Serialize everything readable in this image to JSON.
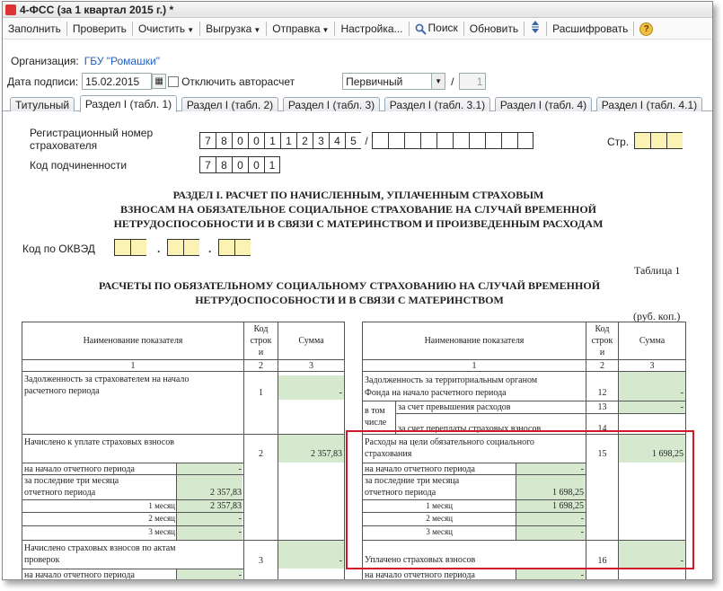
{
  "window": {
    "title": "4-ФСС (за 1 квартал 2015 г.) *"
  },
  "toolbar": {
    "fill": "Заполнить",
    "check": "Проверить",
    "clear": "Очистить",
    "export": "Выгрузка",
    "send": "Отправка",
    "settings": "Настройка...",
    "search": "Поиск",
    "refresh": "Обновить",
    "decrypt": "Расшифровать"
  },
  "org": {
    "label": "Организация:",
    "value": "ГБУ \"Ромашки\""
  },
  "sign": {
    "label": "Дата подписи:",
    "date": "15.02.2015",
    "autocalc_label": "Отключить авторасчет",
    "type": "Первичный",
    "slash": "/",
    "num": "1"
  },
  "tabs": [
    "Титульный",
    "Раздел I (табл. 1)",
    "Раздел I (табл. 2)",
    "Раздел I (табл. 3)",
    "Раздел I (табл. 3.1)",
    "Раздел I (табл. 4)",
    "Раздел I (табл. 4.1)"
  ],
  "header": {
    "reg_label_1": "Регистрационный номер",
    "reg_label_2": "страхователя",
    "reg_digits": [
      "7",
      "8",
      "0",
      "0",
      "1",
      "1",
      "2",
      "3",
      "4",
      "5"
    ],
    "reg_slash": "/",
    "page_label": "Стр.",
    "sub_label": "Код подчиненности",
    "sub_digits": [
      "7",
      "8",
      "0",
      "0",
      "1"
    ],
    "okved_label": "Код по ОКВЭД",
    "okved_dot": "."
  },
  "titles": {
    "section_1": "РАЗДЕЛ I.  РАСЧЕТ ПО НАЧИСЛЕННЫМ, УПЛАЧЕННЫМ СТРАХОВЫМ",
    "section_2": "ВЗНОСАМ НА ОБЯЗАТЕЛЬНОЕ СОЦИАЛЬНОЕ СТРАХОВАНИЕ НА СЛУЧАЙ ВРЕМЕННОЙ",
    "section_3": "НЕТРУДОСПОСОБНОСТИ И В СВЯЗИ С МАТЕРИНСТВОМ И ПРОИЗВЕДЕННЫМ РАСХОДАМ",
    "table_no": "Таблица 1",
    "calc_1": "РАСЧЕТЫ ПО ОБЯЗАТЕЛЬНОМУ СОЦИАЛЬНОМУ СТРАХОВАНИЮ НА СЛУЧАЙ ВРЕМЕННОЙ",
    "calc_2": "НЕТРУДОСПОСОБНОСТИ И В СВЯЗИ С МАТЕРИНСТВОМ",
    "units": "(руб. коп.)"
  },
  "left_table": {
    "h_name": "Наименование показателя",
    "h_code_1": "Код",
    "h_code_2": "строк",
    "h_code_3": "и",
    "h_sum": "Сумма",
    "n1": "1",
    "n2": "2",
    "n3": "3",
    "r1_name_1": "Задолженность за страхователем на начало",
    "r1_name_2": "расчетного периода",
    "r1_code": "1",
    "r1_sum": "-",
    "r2_name": "Начислено к уплате страховых взносов",
    "r2_code": "2",
    "r2_sum": "2 357,83",
    "r2_start": "на начало отчетного периода",
    "r2_start_v": "-",
    "r2_last3_1": "за последние три месяца",
    "r2_last3_2": "отчетного периода",
    "r2_last3_v": "2 357,83",
    "m1": "1 месяц",
    "m1_v": "2 357,83",
    "m2": "2 месяц",
    "m2_v": "-",
    "m3": "3 месяц",
    "m3_v": "-",
    "r3_name_1": "Начислено страховых взносов по актам",
    "r3_name_2": "проверок",
    "r3_code": "3",
    "r3_sum": "-",
    "r3_start": "на начало отчетного периода",
    "r3_start_v": "-"
  },
  "right_table": {
    "h_name": "Наименование показателя",
    "h_code_1": "Код",
    "h_code_2": "строк",
    "h_code_3": "и",
    "h_sum": "Сумма",
    "n1": "1",
    "n2": "2",
    "n3": "3",
    "r12_name_1": "Задолженность за территориальным органом",
    "r12_name_2": "Фонда на  начало расчетного периода",
    "r12_code": "12",
    "r12_sum": "-",
    "incl_1": "в том",
    "incl_2": "числе",
    "r13_name": "за счет превышения расходов",
    "r13_code": "13",
    "r13_sum": "-",
    "r14_name": "за счет переплаты страховых взносов",
    "r14_code": "14",
    "r15_name_1": "Расходы на цели обязательного социального",
    "r15_name_2": "страхования",
    "r15_code": "15",
    "r15_sum": "1 698,25",
    "r15_start": "на начало отчетного периода",
    "r15_start_v": "-",
    "r15_last3_1": "за последние три месяца",
    "r15_last3_2": "отчетного периода",
    "r15_last3_v": "1 698,25",
    "m1": "1 месяц",
    "m1_v": "1 698,25",
    "m2": "2 месяц",
    "m2_v": "-",
    "m3": "3 месяц",
    "m3_v": "-",
    "r16_name": "Уплачено страховых взносов",
    "r16_code": "16",
    "r16_sum": "-",
    "r16_start": "на начало отчетного периода",
    "r16_start_v": "-"
  },
  "colors": {
    "highlight": "#d0182a",
    "input_green": "#d6e9cf",
    "input_yellow": "#fbf3b4"
  }
}
